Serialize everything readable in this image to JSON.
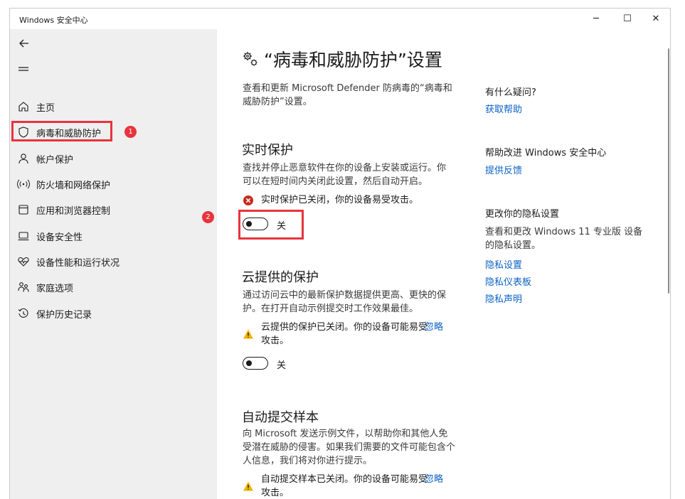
{
  "window": {
    "title": "Windows 安全中心",
    "minimize": "─",
    "maximize": "☐",
    "close": "✕"
  },
  "sidebar": {
    "items": [
      {
        "label": "主页",
        "icon": "home-icon"
      },
      {
        "label": "病毒和威胁防护",
        "icon": "shield-icon"
      },
      {
        "label": "帐户保护",
        "icon": "person-icon"
      },
      {
        "label": "防火墙和网络保护",
        "icon": "wifi-antenna-icon"
      },
      {
        "label": "应用和浏览器控制",
        "icon": "browser-window-icon"
      },
      {
        "label": "设备安全性",
        "icon": "laptop-icon"
      },
      {
        "label": "设备性能和运行状况",
        "icon": "heart-pulse-icon"
      },
      {
        "label": "家庭选项",
        "icon": "family-icon"
      },
      {
        "label": "保护历史记录",
        "icon": "history-icon"
      }
    ]
  },
  "annotations": {
    "badge1": "1",
    "badge2": "2"
  },
  "main": {
    "title": "“病毒和威胁防护”设置",
    "intro": "查看和更新 Microsoft Defender 防病毒的“病毒和威胁防护”设置。",
    "realtime": {
      "heading": "实时保护",
      "desc": "查找并停止恶意软件在你的设备上安装或运行。你可以在短时间内关闭此设置，然后自动开启。",
      "status": "实时保护已关闭，你的设备易受攻击。",
      "toggle_label": "关"
    },
    "cloud": {
      "heading": "云提供的保护",
      "desc": "通过访问云中的最新保护数据提供更高、更快的保护。在打开自动示例提交时工作效果最佳。",
      "status": "云提供的保护已关闭。你的设备可能易受攻击。",
      "dismiss": "忽略",
      "toggle_label": "关"
    },
    "sample": {
      "heading": "自动提交样本",
      "desc": "向 Microsoft 发送示例文件，以帮助你和其他人免受潜在威胁的侵害。如果我们需要的文件可能包含个人信息，我们将对你进行提示。",
      "status": "自动提交样本已关闭。你的设备可能易受攻击。",
      "dismiss": "忽略"
    }
  },
  "right": {
    "question_heading": "有什么疑问?",
    "get_help": "获取帮助",
    "improve_heading": "帮助改进 Windows 安全中心",
    "feedback": "提供反馈",
    "privacy_heading": "更改你的隐私设置",
    "privacy_desc": "查看和更改 Windows 11 专业版 设备的隐私设置。",
    "privacy_settings": "隐私设置",
    "privacy_dashboard": "隐私仪表板",
    "privacy_statement": "隐私声明"
  },
  "colors": {
    "accent": "#0b62c6",
    "annotation": "#e8343c",
    "sidebar_bg": "#efefef",
    "error": "#c42b1c",
    "warning": "#f0b400"
  }
}
